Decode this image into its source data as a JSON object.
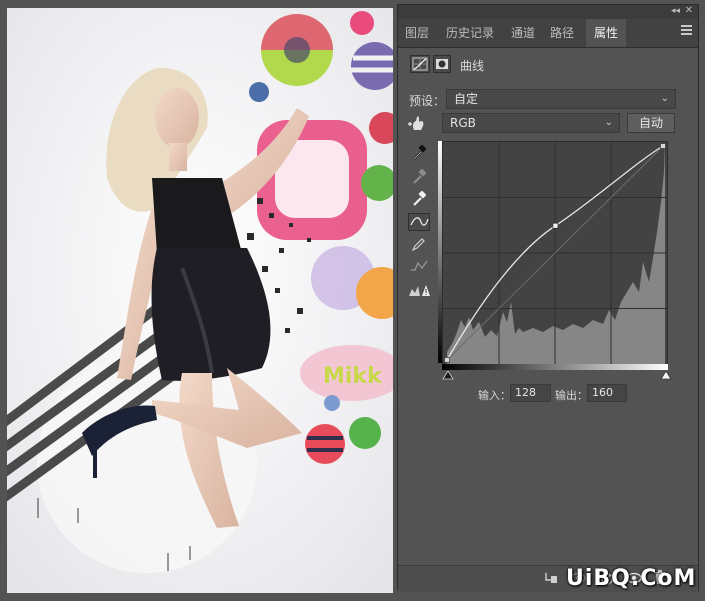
{
  "panel": {
    "tabs": [
      {
        "label": "图层",
        "active": false
      },
      {
        "label": "历史记录",
        "active": false
      },
      {
        "label": "通道",
        "active": false
      },
      {
        "label": "路径",
        "active": false
      },
      {
        "label": "属性",
        "active": true
      }
    ],
    "adjustment_title": "曲线",
    "preset_label": "预设：",
    "preset_value": "自定",
    "channel_value": "RGB",
    "auto_button": "自动",
    "input_label": "输入：",
    "input_value": "128",
    "output_label": "输出：",
    "output_value": "160",
    "curve_points": [
      [
        0,
        0
      ],
      [
        128,
        160
      ],
      [
        255,
        255
      ]
    ]
  },
  "watermark": "UiBQ.CoM",
  "colors": {
    "panel_bg": "#535353",
    "tab_bar": "#424242",
    "graph_bg": "#434343",
    "histogram": "#8a8a8a",
    "curve": "#e6e6e6"
  },
  "icons": [
    "collapse-icon",
    "close-icon",
    "panel-menu-icon",
    "curves-adjustment-icon",
    "layer-mask-icon",
    "target-adjust-hand-icon",
    "black-point-eyedropper-icon",
    "gray-point-eyedropper-icon",
    "white-point-eyedropper-icon",
    "curve-point-tool-icon",
    "pencil-draw-icon",
    "smooth-curve-icon",
    "clipping-warning-icon",
    "clip-to-layer-icon",
    "view-previous-icon",
    "reset-icon",
    "visibility-eye-icon",
    "trash-icon"
  ]
}
